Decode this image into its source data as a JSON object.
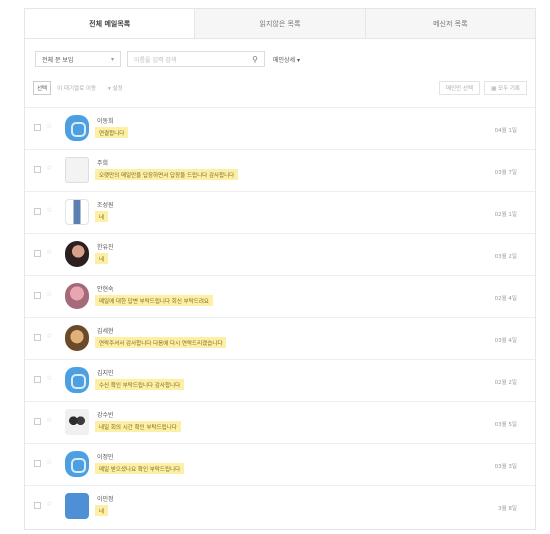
{
  "tabs": [
    {
      "label": "전체 메일목록"
    },
    {
      "label": "읽지않은 목록"
    },
    {
      "label": "메신저 목록"
    }
  ],
  "filter": {
    "select_value": "전체 문 보임",
    "search_placeholder": "이름을 입력 검색",
    "detail_label": "메인상세 ▾"
  },
  "toolbar": {
    "left": [
      "선택",
      "이 대기열로 이동",
      "▾ 설정"
    ],
    "right": [
      "메인만 선택",
      "▦ 모두 기록"
    ]
  },
  "list": [
    {
      "name": "이동희",
      "message": "연결합니다",
      "time": "04월 1일",
      "avatar": "av-blue"
    },
    {
      "name": "주희",
      "message": "오랫만의 메일만을 답장하면서 답장을 드립니다 감사합니다",
      "time": "03월 7일",
      "avatar": "av-doc"
    },
    {
      "name": "조성원",
      "message": "네",
      "time": "02월 1일",
      "avatar": "av-bottle"
    },
    {
      "name": "한유진",
      "message": "네",
      "time": "03월 2일",
      "avatar": "av-dark"
    },
    {
      "name": "안현숙",
      "message": "메일에 대한 답변 부탁드립니다 회신 부탁드려요",
      "time": "02월 4일",
      "avatar": "av-pink"
    },
    {
      "name": "김세현",
      "message": "연락주셔서 감사합니다 다음에 다시 연락드리겠습니다",
      "time": "03월 4일",
      "avatar": "av-brown"
    },
    {
      "name": "김지민",
      "message": "수신 확인 부탁드립니다 감사합니다",
      "time": "02월 2일",
      "avatar": "av-blue"
    },
    {
      "name": "강수빈",
      "message": "내일 회의 시간 확인 부탁드립니다",
      "time": "03월 5일",
      "avatar": "av-people"
    },
    {
      "name": "이정민",
      "message": "메일 받으셨나요 확인 부탁드립니다",
      "time": "03월 3일",
      "avatar": "av-blue"
    },
    {
      "name": "이민정",
      "message": "네",
      "time": "3월 8일",
      "avatar": "av-blue2"
    }
  ]
}
